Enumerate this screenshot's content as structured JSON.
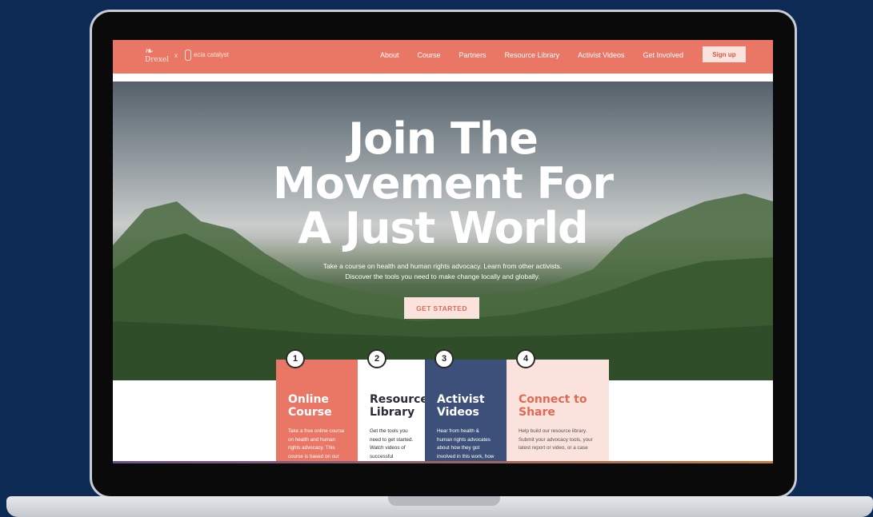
{
  "nav": {
    "logo1": "Drexel",
    "logo_separator": "x",
    "logo2": "ecia catalyst",
    "links": [
      "About",
      "Course",
      "Partners",
      "Resource Library",
      "Activist Videos",
      "Get Involved"
    ],
    "signup": "Sign up"
  },
  "hero": {
    "title_lines": [
      "Join The",
      "Movement For",
      "A Just World"
    ],
    "subtitle": "Take a course on health and human rights advocacy. Learn from other activists. Discover the tools you need to make change locally and globally.",
    "cta": "GET STARTED"
  },
  "cards": [
    {
      "num": "1",
      "title": "Online Course",
      "text": "Take a free online course on health and human rights advocacy. This course is based on our Know It, Prove It, Change It curriculum."
    },
    {
      "num": "2",
      "title": "Resource Library",
      "text": "Get the tools you need to get started. Watch videos of successful advocacy campaigns from around"
    },
    {
      "num": "3",
      "title": "Activist Videos",
      "text": "Hear from health & human rights advocates about how they got involved in this work, how they stay"
    },
    {
      "num": "4",
      "title": "Connect to Share",
      "text": "Help build our resource library. Submit your advocacy tools, your latest report or video, or a case"
    }
  ],
  "colors": {
    "coral": "#ea7766",
    "navy": "#3c5079",
    "peach": "#fbe3dd",
    "background": "#0d2a55"
  }
}
